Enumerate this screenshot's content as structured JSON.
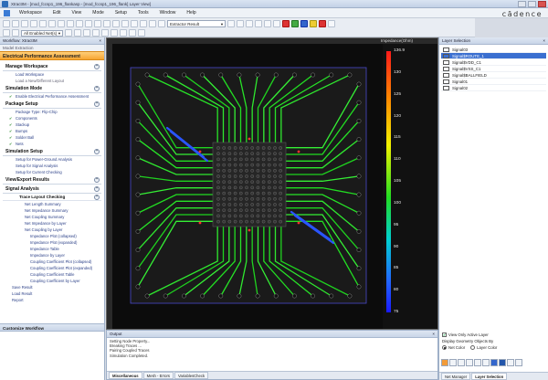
{
  "window": {
    "title": "XtractIM - [mod_fccsp1_196_flankasp - [mod_fccsp1_196_flank] Layer View]"
  },
  "menu": [
    "Workspace",
    "Edit",
    "View",
    "Mode",
    "Setup",
    "Tools",
    "Window",
    "Help"
  ],
  "brand": "cādence",
  "toolbar": {
    "result_select": "Extractor Result",
    "net_filter": "All Enabled Net(s)"
  },
  "workflow": {
    "title": "Workflow: XtractIM",
    "subtitle": "Model Extraction",
    "active": "Electrical Performance Assessment",
    "sections": [
      {
        "label": "Manage Workspace",
        "items": [
          {
            "label": "Load Workspace",
            "style": ""
          },
          {
            "label": "Load a New/Different Layout",
            "style": "dim"
          }
        ]
      },
      {
        "label": "Simulation Mode",
        "items": [
          {
            "label": "Enable Electrical Performance Assessment",
            "style": "check"
          }
        ]
      },
      {
        "label": "Package Setup",
        "items": [
          {
            "label": "Package Type: Flip-Chip",
            "style": ""
          },
          {
            "label": "Components",
            "style": "check"
          },
          {
            "label": "Stackup",
            "style": "check"
          },
          {
            "label": "Bumps",
            "style": "check"
          },
          {
            "label": "Solder Ball",
            "style": "check"
          },
          {
            "label": "Nets",
            "style": "check"
          }
        ]
      },
      {
        "label": "Simulation Setup",
        "items": [
          {
            "label": "Setup for Power-Ground Analysis",
            "style": ""
          },
          {
            "label": "Setup for Signal Analysis",
            "style": ""
          },
          {
            "label": "Setup for Current Checking",
            "style": ""
          }
        ]
      },
      {
        "label": "View/Export Results",
        "items": []
      },
      {
        "label": "Signal Analysis",
        "items": []
      }
    ],
    "trace_check": {
      "label": "Trace Layout Checking",
      "items": [
        {
          "label": "Net Length Summary",
          "level": "l2"
        },
        {
          "label": "Net Impedance Summary",
          "level": "l2"
        },
        {
          "label": "Net Coupling Summary",
          "level": "l2"
        },
        {
          "label": "Net Impedance by Layer",
          "level": "l2"
        },
        {
          "label": "Net Coupling by Layer",
          "level": "l2"
        },
        {
          "label": "Impedance Plot (collapsed)",
          "level": "l3"
        },
        {
          "label": "Impedance Plot (expanded)",
          "level": "l3"
        },
        {
          "label": "Impedance Table",
          "level": "l3"
        },
        {
          "label": "Impedance by Layer",
          "level": "l3"
        },
        {
          "label": "Coupling Coefficient Plot (collapsed)",
          "level": "l3"
        },
        {
          "label": "Coupling Coefficient Plot (expanded)",
          "level": "l3"
        },
        {
          "label": "Coupling Coefficient Table",
          "level": "l3"
        },
        {
          "label": "Coupling Coefficient by Layer",
          "level": "l3"
        }
      ]
    },
    "footer_items": [
      "Save Result",
      "Load Result",
      "Report"
    ],
    "customize": "Customize Workflow"
  },
  "canvas": {
    "scale_title": "Impedance(Ohm)",
    "scale_ticks": [
      "136.9",
      "130",
      "125",
      "120",
      "115",
      "110",
      "105",
      "100",
      "95",
      "90",
      "85",
      "80",
      "75"
    ],
    "scale_colors": {
      "high": "#ff1a1a",
      "low": "#1a1aff"
    }
  },
  "output": {
    "title": "Output",
    "lines": [
      "Setting Node Property...",
      "Breaking Traces ...",
      "Pairing Coupled Traces",
      "Simulation Completed."
    ],
    "tabs": [
      "Miscellaneous",
      "Mesh - Errors",
      "VariablesCheck"
    ]
  },
  "layer_panel": {
    "title": "Layer Selection",
    "layers": [
      {
        "name": "Signal03",
        "color": "#ffffff",
        "selected": false
      },
      {
        "name": "Signal$ROUTE_1",
        "color": "#ffffff",
        "selected": true
      },
      {
        "name": "Signal$VDD_C1",
        "color": "#ffffff",
        "selected": false
      },
      {
        "name": "Signal$VSS_C1",
        "color": "#ffffff",
        "selected": false
      },
      {
        "name": "Signal$BALLFIELD",
        "color": "#ffffff",
        "selected": false
      },
      {
        "name": "Signal01",
        "color": "#ffffff",
        "selected": false
      },
      {
        "name": "Signal02",
        "color": "#ffffff",
        "selected": false
      }
    ],
    "view_only_active": "View Only Active Layer",
    "display_label": "Display Geometry Objects By",
    "radio_net": "Net Color",
    "radio_layer": "Layer Color",
    "tabs": [
      "Net Manager",
      "Layer Selection"
    ]
  }
}
